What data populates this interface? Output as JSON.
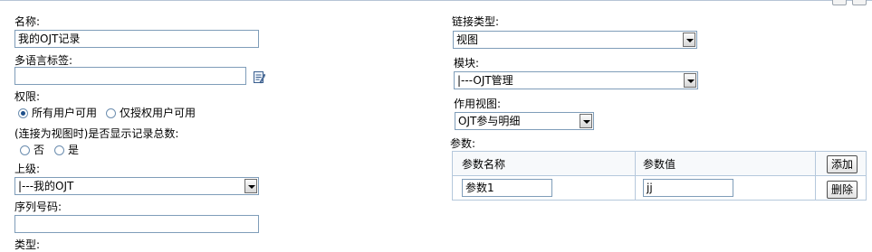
{
  "left": {
    "name_label": "名称:",
    "name_value": "我的OJT记录",
    "multilang_label": "多语言标签:",
    "multilang_value": "",
    "permission_label": "权限:",
    "perm_all": "所有用户可用",
    "perm_authorized": "仅授权用户可用",
    "count_label": "(连接为视图时)是否显示记录总数:",
    "count_no": "否",
    "count_yes": "是",
    "parent_label": "上级:",
    "parent_value": "|---我的OJT",
    "seq_label": "序列号码:",
    "seq_value": "",
    "type_label": "类型:"
  },
  "right": {
    "link_type_label": "链接类型:",
    "link_type_value": "视图",
    "module_label": "模块:",
    "module_value": "|---OJT管理",
    "view_label": "作用视图:",
    "view_value": "OJT参与明细",
    "params_label": "参数:",
    "params": {
      "col_name": "参数名称",
      "col_value": "参数值",
      "add_button": "添加",
      "rows": [
        {
          "name": "参数1",
          "value": "jj",
          "delete_button": "删除"
        }
      ]
    }
  },
  "colors": {
    "border": "#7f9db9",
    "table_border": "#b5c8dc"
  },
  "icons": {
    "multilang": "edit-note-icon",
    "dropdown": "chevron-down-icon"
  }
}
